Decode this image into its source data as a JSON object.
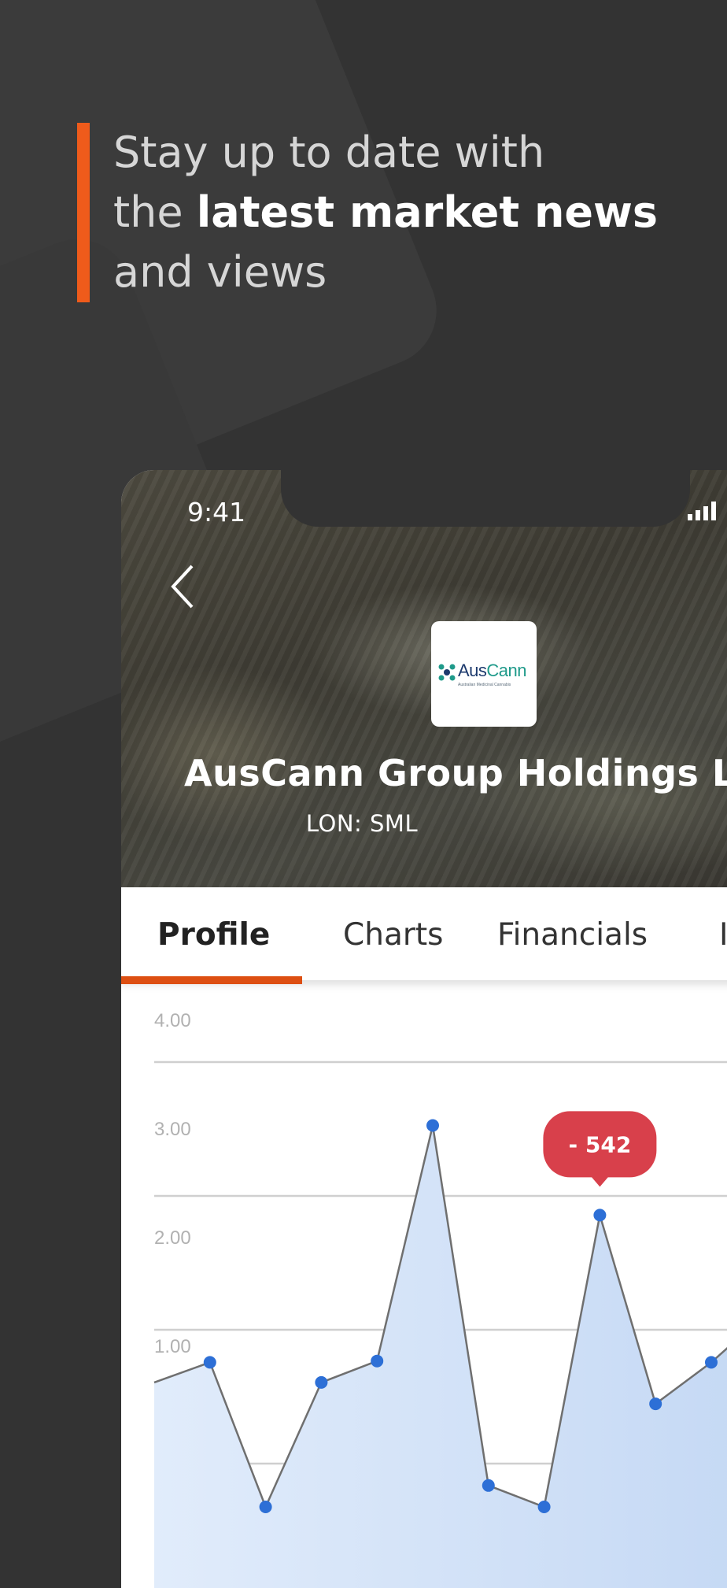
{
  "headline": {
    "line1": "Stay up to date with",
    "line2_prefix": "the ",
    "line2_bold": "latest market news",
    "line3": "and views"
  },
  "status_bar": {
    "time": "9:41"
  },
  "company": {
    "logo_word_a": "Aus",
    "logo_word_b": "Cann",
    "logo_subtitle": "Australian Medicinal Cannabis",
    "name": "AusCann Group Holdings L",
    "ticker": "LON: SML"
  },
  "tabs": [
    {
      "label": "Profile",
      "active": true
    },
    {
      "label": "Charts",
      "active": false
    },
    {
      "label": "Financials",
      "active": false
    },
    {
      "label": "I",
      "active": false
    }
  ],
  "colors": {
    "accent": "#ef5b1b",
    "tab_indicator": "#dd4f12",
    "point": "#2d6fd6",
    "callout": "#d8404b",
    "area_top": "#dbe7fa"
  },
  "chart_data": {
    "type": "area",
    "ylim": [
      0,
      4
    ],
    "y_ticks": [
      "4.00",
      "3.00",
      "2.00",
      "1.00"
    ],
    "grid": true,
    "points": [
      [
        0,
        0.93
      ],
      [
        1,
        1.08
      ],
      [
        2,
        0.0
      ],
      [
        3,
        0.93
      ],
      [
        4,
        1.09
      ],
      [
        5,
        2.85
      ],
      [
        6,
        0.16
      ],
      [
        7,
        0.0
      ],
      [
        8,
        2.18
      ],
      [
        9,
        0.77
      ],
      [
        10,
        1.08
      ],
      [
        11,
        1.45
      ]
    ],
    "callout": {
      "label": "- 542",
      "point_index": 8
    }
  }
}
